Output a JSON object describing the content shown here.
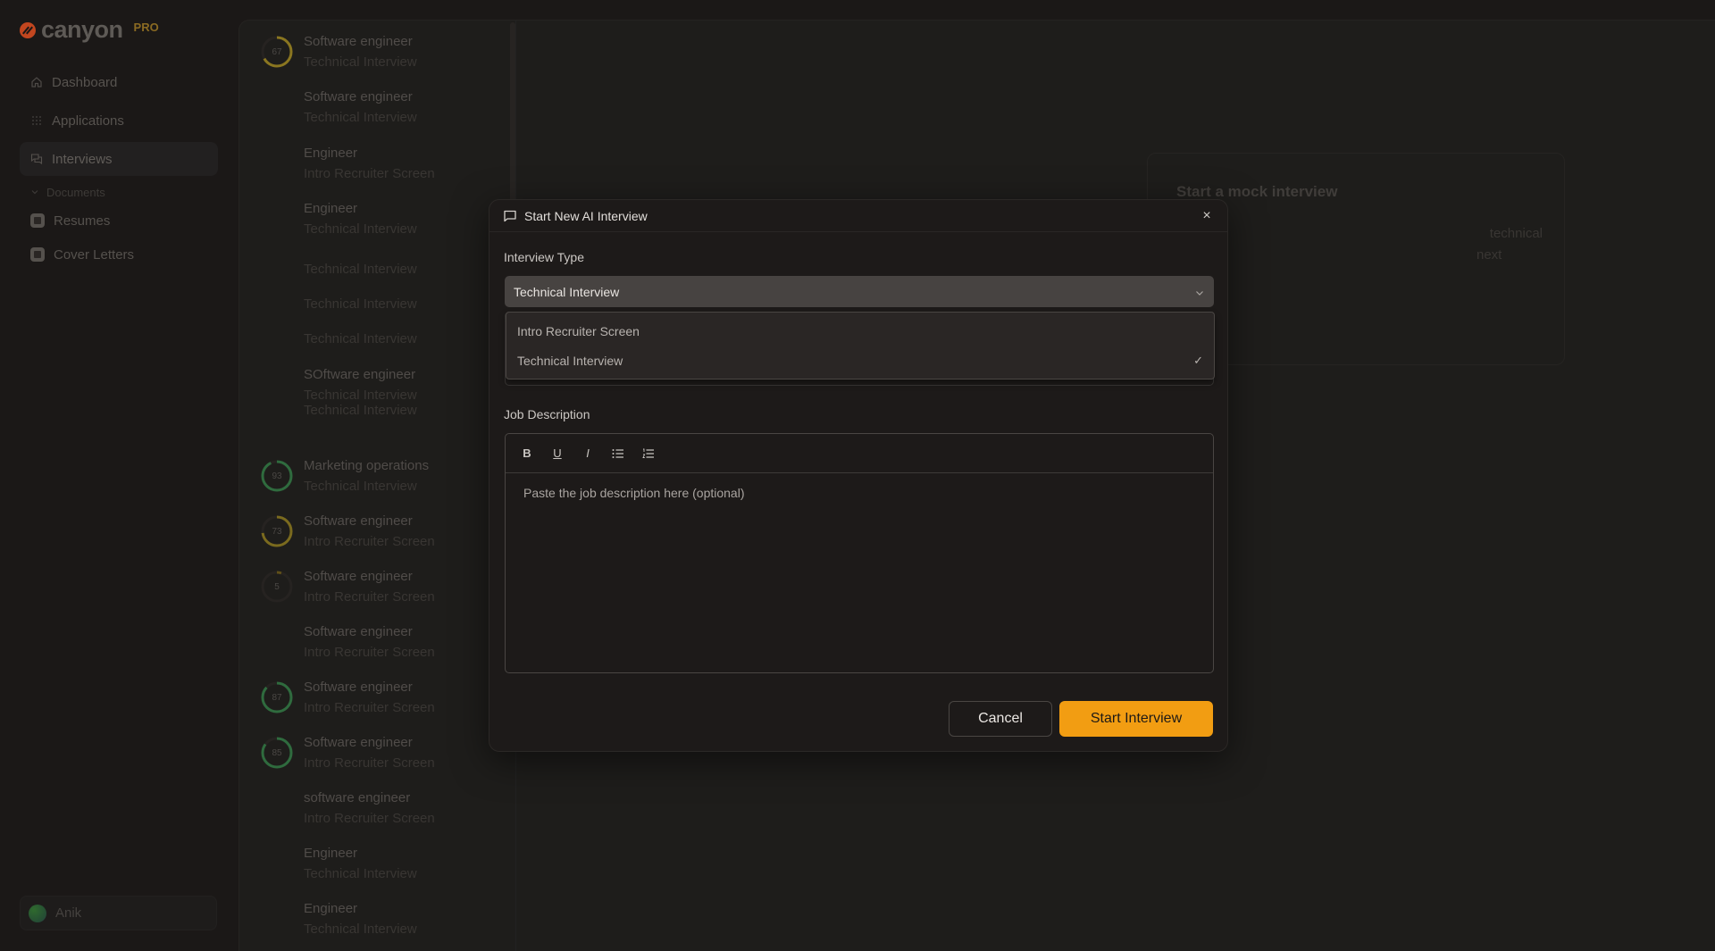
{
  "brand": {
    "name": "canyon",
    "badge": "PRO",
    "accent": "#f29d12",
    "logo_color": "#c2461f"
  },
  "sidebar": {
    "nav": [
      {
        "label": "Dashboard",
        "icon": "home-icon"
      },
      {
        "label": "Applications",
        "icon": "grid-icon"
      },
      {
        "label": "Interviews",
        "icon": "chat-bubbles-icon",
        "active": true
      }
    ],
    "documents_label": "Documents",
    "documents": [
      {
        "label": "Resumes",
        "icon": "resume-icon"
      },
      {
        "label": "Cover Letters",
        "icon": "cover-letter-icon"
      }
    ],
    "user": {
      "name": "Anik"
    }
  },
  "interviews": [
    {
      "title": "Software engineer",
      "type": "Technical Interview",
      "score": 67,
      "score_color": "#8a7620"
    },
    {
      "title": "Software engineer",
      "type": "Technical Interview"
    },
    {
      "title": "Engineer",
      "type": "Intro Recruiter Screen"
    },
    {
      "title": "Engineer",
      "type": "Technical Interview"
    },
    {
      "title": "",
      "type": "Technical Interview"
    },
    {
      "title": "",
      "type": "Technical Interview"
    },
    {
      "title": "",
      "type": "Technical Interview"
    },
    {
      "title": "SOftware engineer",
      "type": "Technical Interview"
    },
    {
      "title": "",
      "type": "Technical Interview"
    },
    {
      "title": "Marketing operations",
      "type": "Technical Interview",
      "score": 93,
      "score_color": "#2f6b3e"
    },
    {
      "title": "Software engineer",
      "type": "Intro Recruiter Screen",
      "score": 73,
      "score_color": "#7a6a1e"
    },
    {
      "title": "Software engineer",
      "type": "Intro Recruiter Screen",
      "score": 5,
      "score_color": "#5f4f18"
    },
    {
      "title": "Software engineer",
      "type": "Intro Recruiter Screen"
    },
    {
      "title": "Software engineer",
      "type": "Intro Recruiter Screen",
      "score": 87,
      "score_color": "#2f6b3e"
    },
    {
      "title": "Software engineer",
      "type": "Intro Recruiter Screen",
      "score": 85,
      "score_color": "#2f6b3e"
    },
    {
      "title": "software engineer",
      "type": "Intro Recruiter Screen"
    },
    {
      "title": "Engineer",
      "type": "Technical Interview"
    },
    {
      "title": "Engineer",
      "type": "Technical Interview"
    }
  ],
  "mock_card": {
    "title": "Start a mock interview",
    "body_line1": "technical",
    "body_line2": "next"
  },
  "modal": {
    "title": "Start New AI Interview",
    "interview_type_label": "Interview Type",
    "interview_type_value": "Technical Interview",
    "interview_type_options": [
      {
        "label": "Intro Recruiter Screen",
        "selected": false
      },
      {
        "label": "Technical Interview",
        "selected": true
      }
    ],
    "job_description_label": "Job Description",
    "job_description_placeholder": "Paste the job description here (optional)",
    "toolbar": {
      "bold": "B",
      "underline": "U",
      "italic": "I"
    },
    "cancel_label": "Cancel",
    "start_label": "Start Interview",
    "check_glyph": "✓",
    "close_glyph": "×"
  }
}
